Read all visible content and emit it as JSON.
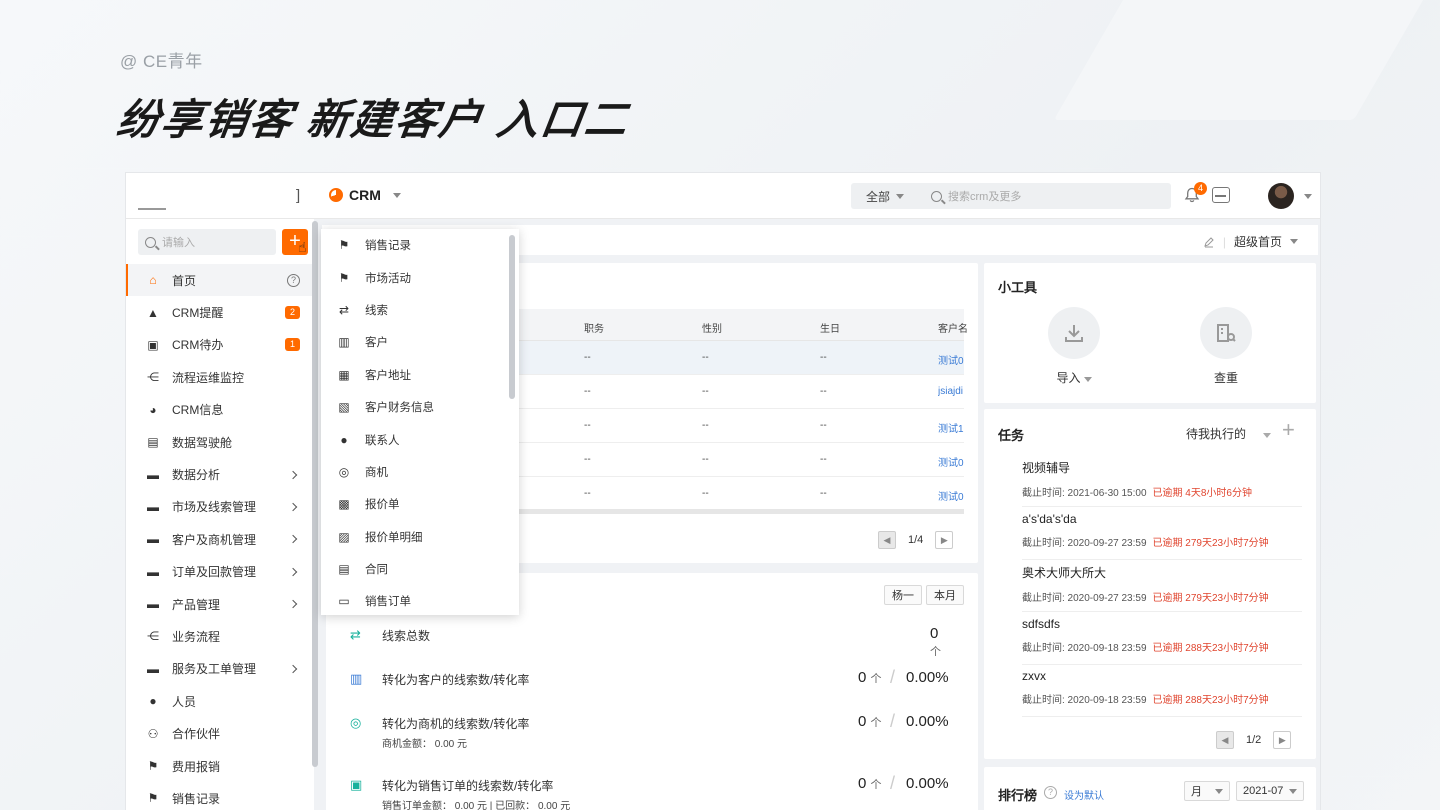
{
  "slide": {
    "credit": "@ CE青年",
    "title": "纷享销客 新建客户 入口二"
  },
  "topbar": {
    "bracket": "]",
    "app_name": "CRM",
    "scope": "全部",
    "search_placeholder": "搜索crm及更多",
    "bell_count": "4"
  },
  "sidebar": {
    "search_placeholder": "请输入",
    "plus": "+",
    "items": [
      {
        "label": "首页",
        "icon": "home-icon",
        "active": true
      },
      {
        "label": "CRM提醒",
        "icon": "bell-icon",
        "badge": "2"
      },
      {
        "label": "CRM待办",
        "icon": "clipboard-icon",
        "badge": "1"
      },
      {
        "label": "流程运维监控",
        "icon": "flow-icon"
      },
      {
        "label": "CRM信息",
        "icon": "pie-icon"
      },
      {
        "label": "数据驾驶舱",
        "icon": "monitor-icon"
      },
      {
        "label": "数据分析",
        "icon": "folder-icon",
        "arrow": true
      },
      {
        "label": "市场及线索管理",
        "icon": "folder-icon",
        "arrow": true
      },
      {
        "label": "客户及商机管理",
        "icon": "folder-icon",
        "arrow": true
      },
      {
        "label": "订单及回款管理",
        "icon": "folder-icon",
        "arrow": true
      },
      {
        "label": "产品管理",
        "icon": "folder-icon",
        "arrow": true
      },
      {
        "label": "业务流程",
        "icon": "flow-icon"
      },
      {
        "label": "服务及工单管理",
        "icon": "folder-icon",
        "arrow": true
      },
      {
        "label": "人员",
        "icon": "person-icon"
      },
      {
        "label": "合作伙伴",
        "icon": "partners-icon"
      },
      {
        "label": "费用报销",
        "icon": "flag-icon"
      },
      {
        "label": "销售记录",
        "icon": "flag-icon"
      }
    ]
  },
  "dropdown": {
    "items": [
      {
        "label": "销售记录",
        "icon": "flag-icon"
      },
      {
        "label": "市场活动",
        "icon": "flag-icon"
      },
      {
        "label": "线索",
        "icon": "lead-icon"
      },
      {
        "label": "客户",
        "icon": "building-icon"
      },
      {
        "label": "客户地址",
        "icon": "address-icon"
      },
      {
        "label": "客户财务信息",
        "icon": "finance-icon"
      },
      {
        "label": "联系人",
        "icon": "contact-icon"
      },
      {
        "label": "商机",
        "icon": "target-icon"
      },
      {
        "label": "报价单",
        "icon": "quote-icon"
      },
      {
        "label": "报价单明细",
        "icon": "quote-detail-icon"
      },
      {
        "label": "合同",
        "icon": "contract-icon"
      },
      {
        "label": "销售订单",
        "icon": "order-icon"
      }
    ]
  },
  "header": {
    "homepage": "超级首页"
  },
  "contacts_table": {
    "columns": [
      "职务",
      "性别",
      "生日",
      "客户名"
    ],
    "rows": [
      [
        "--",
        "--",
        "--",
        "测试0"
      ],
      [
        "--",
        "--",
        "--",
        "jsiajdi"
      ],
      [
        "--",
        "--",
        "--",
        "测试1"
      ],
      [
        "--",
        "--",
        "--",
        "测试0"
      ],
      [
        "--",
        "--",
        "--",
        "测试0"
      ]
    ],
    "page": "1/4"
  },
  "funnel": {
    "owner_chip": "杨一",
    "period_chip": "本月",
    "rows": [
      {
        "label": "线索总数",
        "value": "0",
        "unit": "个",
        "rate": "",
        "sub": ""
      },
      {
        "label": "转化为客户的线索数/转化率",
        "value": "0",
        "unit": "个",
        "rate": "0.00%",
        "sub": ""
      },
      {
        "label": "转化为商机的线索数/转化率",
        "value": "0",
        "unit": "个",
        "rate": "0.00%",
        "sub": "商机金额：  0.00 元"
      },
      {
        "label": "转化为销售订单的线索数/转化率",
        "value": "0",
        "unit": "个",
        "rate": "0.00%",
        "sub": "销售订单金额：  0.00 元   |   已回款：  0.00 元"
      }
    ]
  },
  "tools": {
    "title": "小工具",
    "items": [
      {
        "label": "导入",
        "icon": "download-icon"
      },
      {
        "label": "查重",
        "icon": "dedupe-icon"
      }
    ]
  },
  "tasks": {
    "title": "任务",
    "filter": "待我执行的",
    "items": [
      {
        "name": "视频辅导",
        "deadline": "截止时间:  2021-06-30 15:00",
        "overdue": "已逾期  4天8小时6分钟"
      },
      {
        "name": "a's'da's'da",
        "deadline": "截止时间:  2020-09-27 23:59",
        "overdue": "已逾期  279天23小时7分钟"
      },
      {
        "name": "奥术大师大所大",
        "deadline": "截止时间:  2020-09-27 23:59",
        "overdue": "已逾期  279天23小时7分钟"
      },
      {
        "name": "sdfsdfs",
        "deadline": "截止时间:  2020-09-18 23:59",
        "overdue": "已逾期  288天23小时7分钟"
      },
      {
        "name": "zxvx",
        "deadline": "截止时间:  2020-09-18 23:59",
        "overdue": "已逾期  288天23小时7分钟"
      }
    ],
    "page": "1/2"
  },
  "ranking": {
    "title": "排行榜",
    "set_default": "设为默认",
    "period": "月",
    "month": "2021-07"
  }
}
